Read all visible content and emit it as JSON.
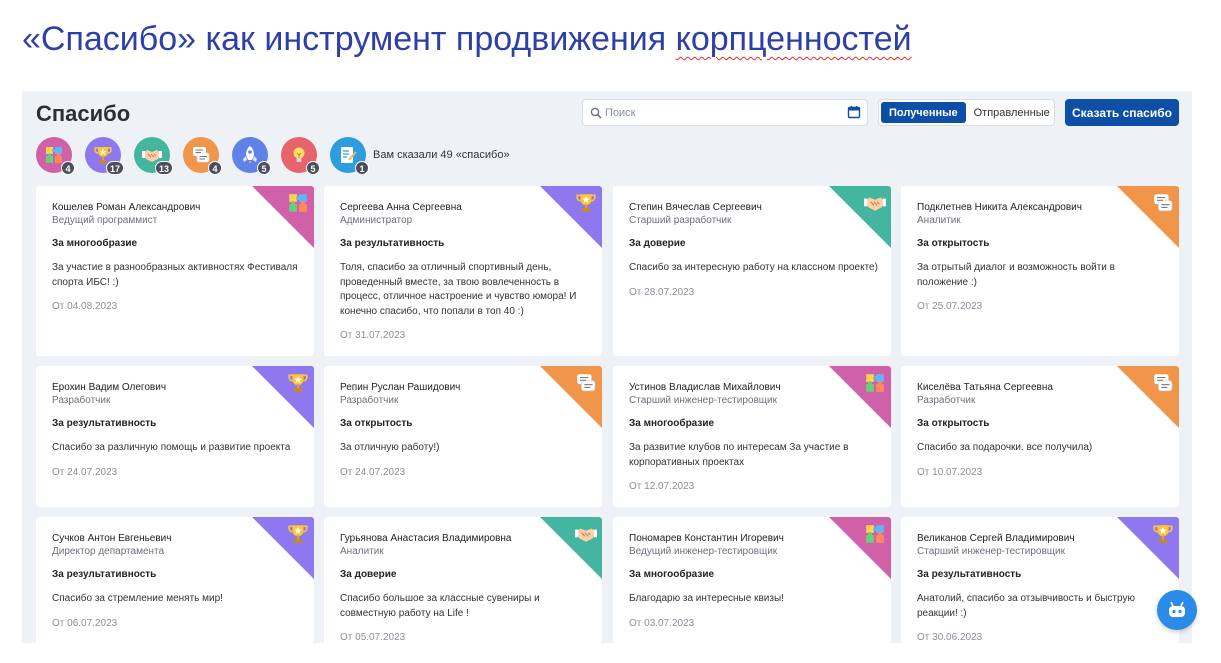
{
  "slide": {
    "title_main": "«Спасибо» как инструмент продвижения ",
    "title_tail": "корпценностей"
  },
  "app": {
    "title": "Спасибо",
    "search_placeholder": "Поиск",
    "tabs": [
      {
        "label": "Полученные",
        "active": true
      },
      {
        "label": "Отправленные",
        "active": false
      }
    ],
    "thanks_button": "Сказать спасибо"
  },
  "colors": {
    "diversity": "#d061a8",
    "results": "#8f78ef",
    "trust": "#44b59e",
    "openness": "#f0954a",
    "rocket": "#5f82e8",
    "idea": "#e8646b",
    "task": "#2e9de0",
    "primary": "#0d4ea6"
  },
  "badges": [
    {
      "icon": "puzzle-icon",
      "color": "diversity",
      "count": "4"
    },
    {
      "icon": "trophy-icon",
      "color": "results",
      "count": "17"
    },
    {
      "icon": "handshake-icon",
      "color": "trust",
      "count": "13"
    },
    {
      "icon": "chat-icon",
      "color": "openness",
      "count": "4"
    },
    {
      "icon": "rocket-icon",
      "color": "rocket",
      "count": "5"
    },
    {
      "icon": "lightbulb-icon",
      "color": "idea",
      "count": "5"
    },
    {
      "icon": "checklist-icon",
      "color": "task",
      "count": "1"
    }
  ],
  "badges_total": "Вам сказали 49 «спасибо»",
  "cards": [
    {
      "name": "Кошелев Роман Александрович",
      "role": "Ведущий программист",
      "category": "За многообразие",
      "message": "За участие в разнообразных активностях Фестиваля спорта ИБС! :)",
      "date": "От 04.08.2023",
      "color": "diversity",
      "icon": "puzzle-icon"
    },
    {
      "name": "Сергеева Анна Сергеевна",
      "role": "Администратор",
      "category": "За результативность",
      "message": "Толя, спасибо за отличный спортивный день, проведенный вместе, за твою вовлеченность в процесс, отличное настроение и чувство юмора! И конечно спасибо, что попали в топ 40 :)",
      "date": "От 31.07.2023",
      "color": "results",
      "icon": "trophy-icon"
    },
    {
      "name": "Степин Вячеслав Сергеевич",
      "role": "Старший разработчик",
      "category": "За доверие",
      "message": "Спасибо за интересную работу на классном проекте)",
      "date": "От 28.07.2023",
      "color": "trust",
      "icon": "handshake-icon"
    },
    {
      "name": "Подклетнев Никита Александрович",
      "role": "Аналитик",
      "category": "За открытость",
      "message": "За отрытый диалог и возможность войти в положение :)",
      "date": "От 25.07.2023",
      "color": "openness",
      "icon": "chat-icon"
    },
    {
      "name": "Ерохин Вадим Олегович",
      "role": "Разработчик",
      "category": "За результативность",
      "message": "Спасибо за различную помощь и развитие проекта",
      "date": "От 24.07.2023",
      "color": "results",
      "icon": "trophy-icon"
    },
    {
      "name": "Репин Руслан Рашидович",
      "role": "Разработчик",
      "category": "За открытость",
      "message": "За отличную работу!)",
      "date": "От 24.07.2023",
      "color": "openness",
      "icon": "chat-icon"
    },
    {
      "name": "Устинов Владислав Михайлович",
      "role": "Старший инженер-тестировщик",
      "category": "За многообразие",
      "message": "За развитие клубов по интересам За участие в корпоративных проектах",
      "date": "От 12.07.2023",
      "color": "diversity",
      "icon": "puzzle-icon"
    },
    {
      "name": "Киселёва Татьяна Сергеевна",
      "role": "Разработчик",
      "category": "За открытость",
      "message": "Спасибо за подарочки. все получила)",
      "date": "От 10.07.2023",
      "color": "openness",
      "icon": "chat-icon"
    },
    {
      "name": "Сучков Антон Евгеньевич",
      "role": "Директор департамента",
      "category": "За результативность",
      "message": "Спасибо за стремление менять мир!",
      "date": "От 06.07.2023",
      "color": "results",
      "icon": "trophy-icon"
    },
    {
      "name": "Гурьянова Анастасия Владимировна",
      "role": "Аналитик",
      "category": "За доверие",
      "message": "Спасибо большое за классные сувениры и совместную работу на Life !",
      "date": "От 05.07.2023",
      "color": "trust",
      "icon": "handshake-icon"
    },
    {
      "name": "Пономарев Константин Игоревич",
      "role": "Ведущий инженер-тестировщик",
      "category": "За многообразие",
      "message": "Благодарю за интересные квизы!",
      "date": "От 03.07.2023",
      "color": "diversity",
      "icon": "puzzle-icon"
    },
    {
      "name": "Великанов Сергей Владимирович",
      "role": "Старший инженер-тестировщик",
      "category": "За результативность",
      "message": "Анатолий, спасибо за отзывчивость и быструю реакции! :)",
      "date": "От 30.06.2023",
      "color": "results",
      "icon": "trophy-icon"
    }
  ]
}
